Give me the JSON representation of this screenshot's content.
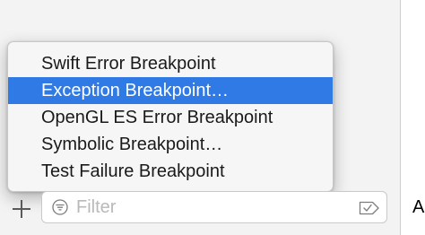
{
  "menu": {
    "items": [
      {
        "label": "Swift Error Breakpoint",
        "selected": false
      },
      {
        "label": "Exception Breakpoint…",
        "selected": true
      },
      {
        "label": "OpenGL ES Error Breakpoint",
        "selected": false
      },
      {
        "label": "Symbolic Breakpoint…",
        "selected": false
      },
      {
        "label": "Test Failure Breakpoint",
        "selected": false
      }
    ]
  },
  "footer": {
    "add_icon": "plus-icon",
    "filter": {
      "icon": "filter-icon",
      "value": "",
      "placeholder": "Filter",
      "trailing_icon": "tag-icon"
    }
  },
  "right_pane": {
    "label": "A"
  },
  "colors": {
    "selection": "#2f7ae5",
    "panel_background": "#f3f3f3",
    "menu_background": "#f6f6f6"
  }
}
